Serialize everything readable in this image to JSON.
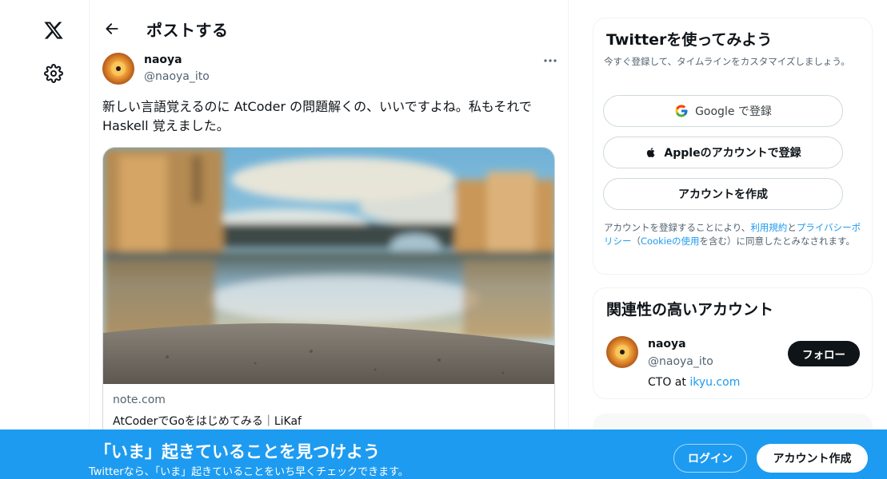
{
  "nav": {
    "logo_icon": "x-logo-icon",
    "settings_icon": "gear-icon"
  },
  "header": {
    "title": "ポストする",
    "back_icon": "arrow-left-icon"
  },
  "post": {
    "author_name": "naoya",
    "author_handle": "@naoya_ito",
    "more_icon": "more-horizontal-icon",
    "text": "新しい言語覚えるのに AtCoder の問題解くの、いいですよね。私もそれで Haskell 覚えました。",
    "card": {
      "domain": "note.com",
      "title": "AtCoderでGoをはじめてみる｜LiKaf"
    }
  },
  "signup": {
    "title": "Twitterを使ってみよう",
    "subtitle": "今すぐ登録して、タイムラインをカスタマイズしましょう。",
    "google_label": "Google で登録",
    "apple_label": "Appleのアカウントで登録",
    "create_label": "アカウントを作成",
    "legal_prefix": "アカウントを登録することにより、",
    "legal_terms": "利用規約",
    "legal_and": "と",
    "legal_privacy": "プライバシーポリシー",
    "legal_paren_open": "（",
    "legal_cookie": "Cookieの使用",
    "legal_suffix": "を含む）に同意したとみなされます。"
  },
  "related": {
    "title": "関連性の高いアカウント",
    "name": "naoya",
    "handle": "@naoya_ito",
    "bio_prefix": "CTO at ",
    "bio_link": "ikyu.com",
    "follow_label": "フォロー"
  },
  "banner": {
    "title": "「いま」起きていることを見つけよう",
    "subtitle": "Twitterなら、「いま」起きていることをいち早くチェックできます。",
    "login_label": "ログイン",
    "create_label": "アカウント作成"
  },
  "colors": {
    "accent": "#1d9bf0",
    "text": "#0f1419",
    "muted": "#536471",
    "border": "#cfd9de"
  }
}
